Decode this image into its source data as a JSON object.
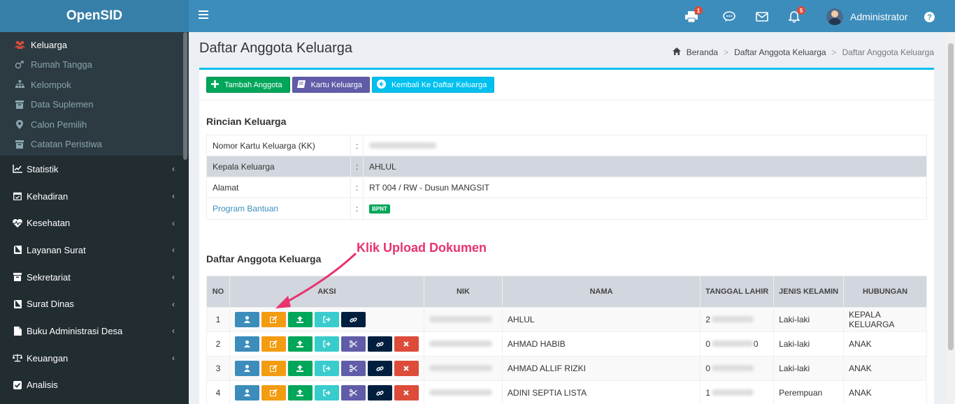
{
  "app": {
    "title": "OpenSID"
  },
  "topbar": {
    "print_badge": "1",
    "notif_badge": "5",
    "user_name": "Administrator"
  },
  "sidebar": {
    "submenu": [
      {
        "label": "Keluarga",
        "icon": "users-icon",
        "active": true
      },
      {
        "label": "Rumah Tangga",
        "icon": "male-female-icon",
        "active": false
      },
      {
        "label": "Kelompok",
        "icon": "sitemap-icon",
        "active": false
      },
      {
        "label": "Data Suplemen",
        "icon": "archive-icon",
        "active": false
      },
      {
        "label": "Calon Pemilih",
        "icon": "location-icon",
        "active": false
      },
      {
        "label": "Catatan Peristiwa",
        "icon": "calendar-icon",
        "active": false
      }
    ],
    "menu": [
      {
        "label": "Statistik",
        "icon": "chart-icon"
      },
      {
        "label": "Kehadiran",
        "icon": "calendar-check-icon"
      },
      {
        "label": "Kesehatan",
        "icon": "heartbeat-icon"
      },
      {
        "label": "Layanan Surat",
        "icon": "book-icon"
      },
      {
        "label": "Sekretariat",
        "icon": "archive-icon"
      },
      {
        "label": "Surat Dinas",
        "icon": "book-icon"
      },
      {
        "label": "Buku Administrasi Desa",
        "icon": "file-icon"
      },
      {
        "label": "Keuangan",
        "icon": "balance-icon"
      },
      {
        "label": "Analisis",
        "icon": "check-square-icon"
      }
    ]
  },
  "page": {
    "title": "Daftar Anggota Keluarga",
    "breadcrumb": [
      "Beranda",
      "Daftar Anggota Keluarga",
      "Daftar Anggota Keluarga"
    ]
  },
  "toolbar": {
    "add": "Tambah Anggota",
    "kk": "Kartu Keluarga",
    "back": "Kembali Ke Daftar Keluarga"
  },
  "rincian": {
    "title": "Rincian Keluarga",
    "rows": [
      {
        "label": "Nomor Kartu Keluarga (KK)",
        "value": ""
      },
      {
        "label": "Kepala Keluarga",
        "value": "AHLUL"
      },
      {
        "label": "Alamat",
        "value": "RT 004 / RW - Dusun MANGSIT"
      },
      {
        "label": "Program Bantuan",
        "value": "BPNT"
      }
    ],
    "colon": ":"
  },
  "annotation": "Klik Upload Dokumen",
  "anggota": {
    "title": "Daftar Anggota Keluarga",
    "headers": [
      "NO",
      "AKSI",
      "NIK",
      "NAMA",
      "TANGGAL LAHIR",
      "JENIS KELAMIN",
      "HUBUNGAN"
    ],
    "rows": [
      {
        "no": "1",
        "nama": "AHLUL",
        "tgl": "2",
        "jk": "Laki-laki",
        "hub": "KEPALA KELUARGA"
      },
      {
        "no": "2",
        "nama": "AHMAD HABIB",
        "tgl": "0",
        "tgl_end": "0",
        "jk": "Laki-laki",
        "hub": "ANAK"
      },
      {
        "no": "3",
        "nama": "AHMAD ALLIF RIZKI",
        "tgl": "0",
        "jk": "Laki-laki",
        "hub": "ANAK"
      },
      {
        "no": "4",
        "nama": "ADINI SEPTIA LISTA",
        "tgl": "1",
        "jk": "Perempuan",
        "hub": "ANAK"
      }
    ]
  },
  "colors": {
    "header": "#3c8dbc",
    "logo": "#367fa9",
    "sidebar": "#222d32",
    "accent": "#00c0ef",
    "annotation": "#e8336d"
  }
}
